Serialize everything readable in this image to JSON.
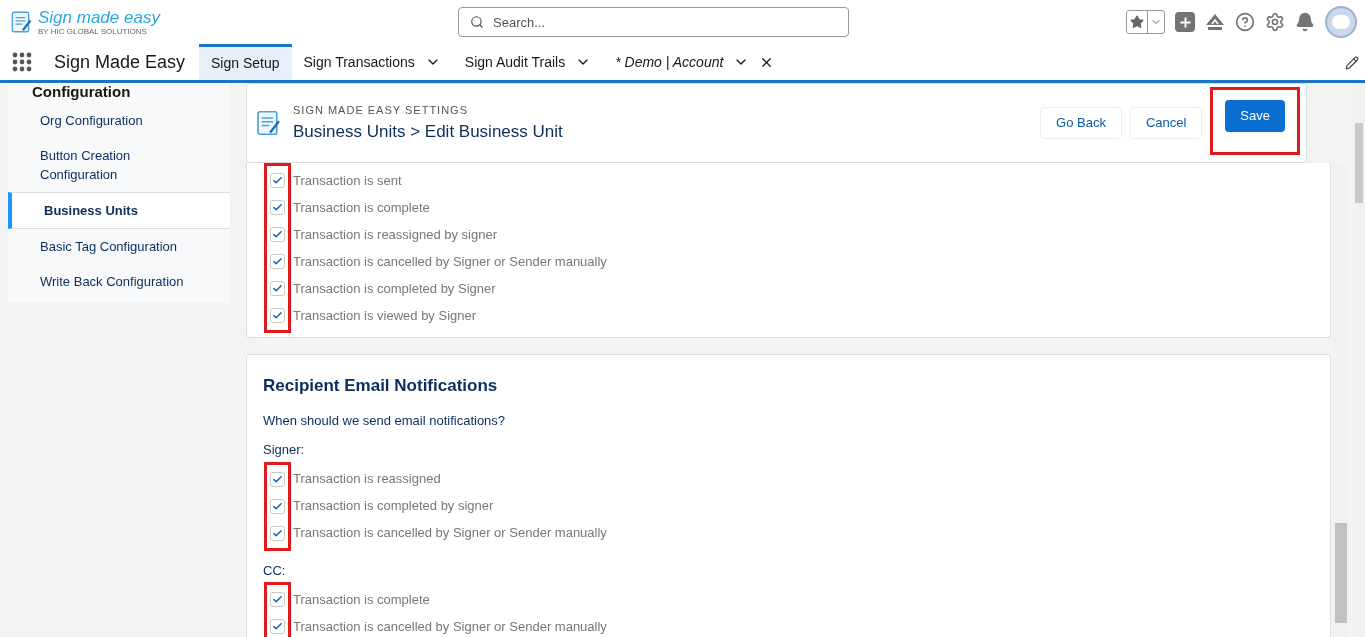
{
  "brand": {
    "name": "Sign made easy",
    "tagline": "BY HIC GLOBAL SOLUTIONS"
  },
  "search": {
    "placeholder": "Search..."
  },
  "app_name": "Sign Made Easy",
  "tabs": [
    {
      "label": "Sign Setup",
      "selected": true,
      "italic": false,
      "dropdown": false,
      "closable": false
    },
    {
      "label": "Sign Transactions",
      "selected": false,
      "italic": false,
      "dropdown": true,
      "closable": false
    },
    {
      "label": "Sign Audit Trails",
      "selected": false,
      "italic": false,
      "dropdown": true,
      "closable": false
    },
    {
      "label": "* Demo | Account",
      "selected": false,
      "italic": true,
      "dropdown": true,
      "closable": true
    }
  ],
  "sidebar": {
    "heading": "Configuration",
    "items": [
      {
        "label": "Org Configuration",
        "selected": false
      },
      {
        "label": "Button Creation Configuration",
        "selected": false
      },
      {
        "label": "Business Units",
        "selected": true
      },
      {
        "label": "Basic Tag Configuration",
        "selected": false
      },
      {
        "label": "Write Back Configuration",
        "selected": false
      }
    ]
  },
  "header": {
    "eyebrow": "SIGN MADE EASY SETTINGS",
    "title": "Business Units > Edit Business Unit",
    "buttons": [
      {
        "label": "Go Back",
        "kind": "neutral",
        "annotated": false
      },
      {
        "label": "Cancel",
        "kind": "neutral",
        "annotated": false
      },
      {
        "label": "Save",
        "kind": "brand",
        "annotated": true
      }
    ]
  },
  "sender_card": {
    "groups": [
      {
        "annotated": true,
        "options": [
          {
            "label": "Transaction is sent",
            "checked": true
          },
          {
            "label": "Transaction is complete",
            "checked": true
          },
          {
            "label": "Transaction is reassigned by signer",
            "checked": true
          },
          {
            "label": "Transaction is cancelled by Signer or Sender manually",
            "checked": true
          },
          {
            "label": "Transaction is completed by Signer",
            "checked": true
          },
          {
            "label": "Transaction is viewed by Signer",
            "checked": true
          }
        ]
      }
    ]
  },
  "recipient_card": {
    "title": "Recipient Email Notifications",
    "question": "When should we send email notifications?",
    "groups": [
      {
        "label": "Signer:",
        "annotated": true,
        "options": [
          {
            "label": "Transaction is reassigned",
            "checked": true
          },
          {
            "label": "Transaction is completed by signer",
            "checked": true
          },
          {
            "label": "Transaction is cancelled by Signer or Sender manually",
            "checked": true
          }
        ]
      },
      {
        "label": "CC:",
        "annotated": true,
        "options": [
          {
            "label": "Transaction is complete",
            "checked": true
          },
          {
            "label": "Transaction is cancelled by Signer or Sender manually",
            "checked": true
          }
        ]
      }
    ]
  }
}
